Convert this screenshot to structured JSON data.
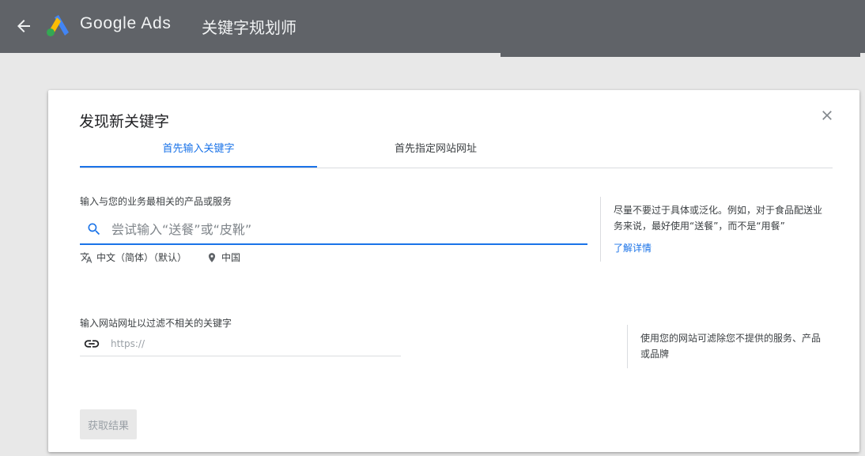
{
  "topbar": {
    "back_icon": "arrow-left-icon",
    "logo_icon": "google-ads-logo-icon",
    "product_name": "Google Ads",
    "tool_name": "关键字规划师"
  },
  "dialog": {
    "title": "发现新关键字",
    "close_icon": "close-icon",
    "tabs": [
      {
        "label": "首先输入关键字",
        "active": true
      },
      {
        "label": "首先指定网站网址",
        "active": false
      }
    ],
    "keywords_section": {
      "label": "输入与您的业务最相关的产品或服务",
      "search_icon": "search-icon",
      "placeholder": "尝试输入“送餐”或“皮靴”",
      "value": "",
      "language_icon": "translate-icon",
      "language": "中文（简体）（默认）",
      "location_icon": "location-pin-icon",
      "location": "中国",
      "help_text": "尽量不要过于具体或泛化。例如，对于食品配送业务来说，最好使用“送餐”，而不是“用餐”",
      "learn_more": "了解详情"
    },
    "url_section": {
      "label": "输入网站网址以过滤不相关的关键字",
      "link_icon": "link-icon",
      "placeholder": "https://",
      "value": "",
      "help_text": "使用您的网站可滤除您不提供的服务、产品或品牌"
    },
    "submit_label": "获取结果"
  },
  "colors": {
    "topbar": "#606368",
    "accent": "#1a73e8",
    "ads_blue": "#4285f4",
    "ads_yellow": "#fbbc04",
    "ads_green": "#34a853"
  }
}
